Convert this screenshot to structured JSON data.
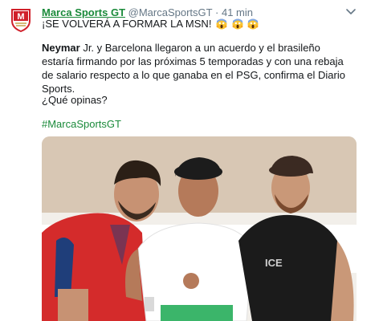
{
  "tweet": {
    "display_name": "Marca Sports GT",
    "handle": "@MarcaSportsGT",
    "separator": "·",
    "time": "41 min",
    "headline": "¡SE VOLVERÁ A FORMAR LA MSN!",
    "emoji_name": "face-screaming-in-fear",
    "paragraph1_bold": "Neymar",
    "paragraph1_rest": " Jr. y Barcelona llegaron a un acuerdo y el brasileño estaría firmando por las próximas 5 temporadas y con una rebaja de salario respecto a lo que ganaba en el PSG, confirma el Diario Sports.",
    "paragraph2": "¿Qué opinas?",
    "hashtag": "#MarcaSportsGT",
    "avatar_letter": "M"
  },
  "colors": {
    "accent": "#1a8a3a",
    "muted": "#657786",
    "text": "#14171a",
    "logo_red": "#d0202a"
  },
  "icons": {
    "menu": "chevron-down-icon",
    "avatar": "marca-shield-logo"
  },
  "media": {
    "type": "photo",
    "shirt_text": "ICE"
  }
}
